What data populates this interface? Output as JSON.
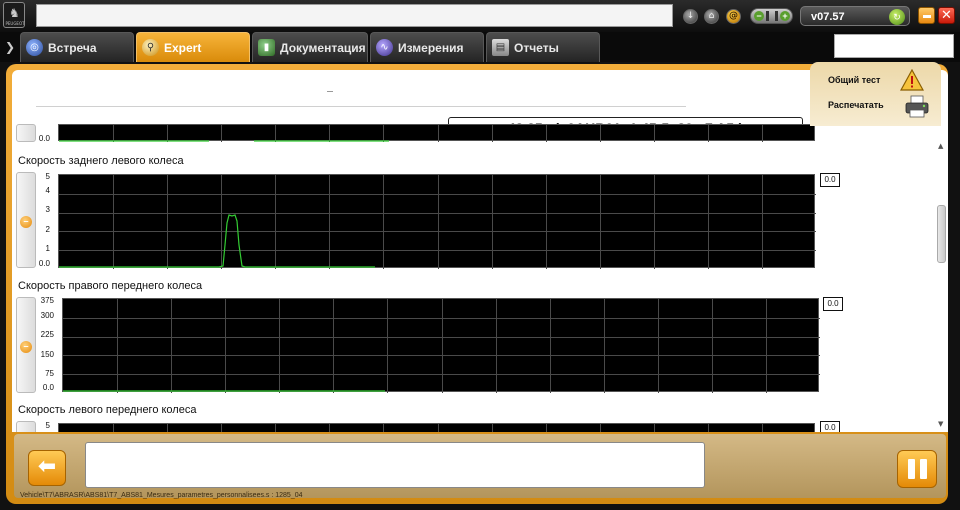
{
  "titlebar": {
    "logo_text": "PEUGEOT",
    "version": "v07.57"
  },
  "tabs": [
    {
      "label": "Встреча",
      "icon": "steering-wheel-icon",
      "active": false
    },
    {
      "label": "Expert",
      "icon": "magnifier-icon",
      "active": true
    },
    {
      "label": "Документация",
      "icon": "book-icon",
      "active": false
    },
    {
      "label": "Измерения",
      "icon": "waveform-icon",
      "active": false
    },
    {
      "label": "Отчеты",
      "icon": "report-icon",
      "active": false
    }
  ],
  "header": {
    "time_readout": "43.25s (<0AHB01: 1 45;5=89 =7 A5:)"
  },
  "side_panel": {
    "general_test_label": "Общий тест",
    "print_label": "Распечатать"
  },
  "charts": [
    {
      "name": "previous-chart",
      "title": "",
      "yticks": [
        "0.0"
      ],
      "value": ""
    },
    {
      "name": "rear-left-wheel-speed",
      "title": "Скорость заднего левого колеса",
      "yticks": [
        "5",
        "4",
        "3",
        "2",
        "1",
        "0.0"
      ],
      "value": "0.0"
    },
    {
      "name": "front-right-wheel-speed",
      "title": "Скорость правого переднего колеса",
      "yticks": [
        "375",
        "300",
        "225",
        "150",
        "75",
        "0.0"
      ],
      "value": "0.0"
    },
    {
      "name": "front-left-wheel-speed",
      "title": "Скорость левого переднего колеса",
      "yticks": [
        "5"
      ],
      "value": "0.0"
    }
  ],
  "footer": {
    "path": "Vehicle\\T7\\ABRASR\\ABS81\\T7_ABS81_Mesures_parametres_personnalisees.s : 1285_04"
  },
  "colors": {
    "accent": "#F0A830",
    "trace": "#33CC33",
    "plot_bg": "#000000"
  }
}
